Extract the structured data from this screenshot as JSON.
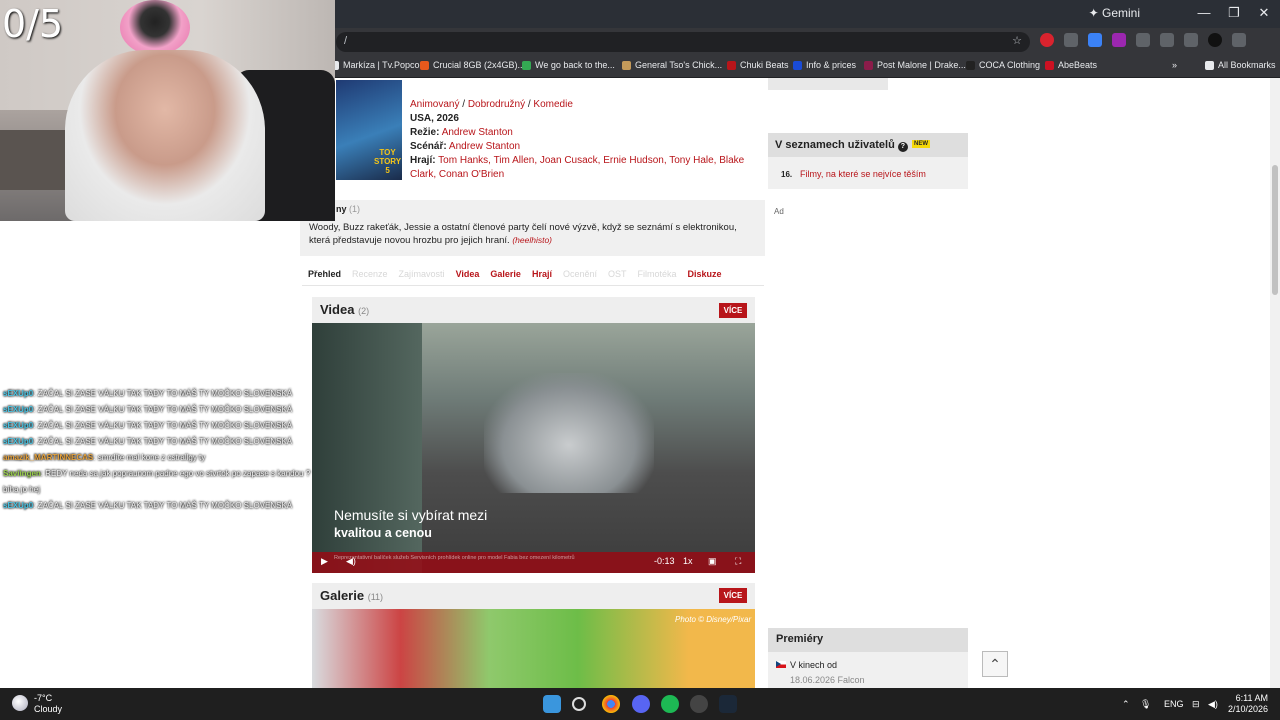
{
  "browser": {
    "gemini_label": "✦ Gemini",
    "minimize": "—",
    "restore": "❐",
    "close": "✕",
    "address": "/",
    "bookmarks": [
      {
        "label": "Markíza | Tv.Popcor...",
        "color": "#e8eaed"
      },
      {
        "label": "Crucial 8GB (2x4GB)...",
        "color": "#e8591c"
      },
      {
        "label": "We go back to the...",
        "color": "#34a853"
      },
      {
        "label": "General Tso's Chick...",
        "color": "#c49a5a"
      },
      {
        "label": "Chuki Beats",
        "color": "#b8151a"
      },
      {
        "label": "Info & prices",
        "color": "#1a4bd6"
      },
      {
        "label": "Post Malone | Drake...",
        "color": "#8b1c4a"
      },
      {
        "label": "COCA Clothing",
        "color": "#222222"
      },
      {
        "label": "AbeBeats",
        "color": "#cc1122"
      }
    ],
    "more_bookmarks": "»",
    "all_bookmarks": "All Bookmarks"
  },
  "film": {
    "genres": [
      "Animovaný",
      "Dobrodružný",
      "Komedie"
    ],
    "origin": "USA, 2026",
    "director_label": "Režie:",
    "director": "Andrew Stanton",
    "writer_label": "Scénář:",
    "writer": "Andrew Stanton",
    "cast_label": "Hrají:",
    "cast": "Tom Hanks, Tim Allen, Joan Cusack, Ernie Hudson, Tony Hale, Blake Clark, Conan O'Brien",
    "poster_logo_1": "TOY",
    "poster_logo_2": "STORY",
    "poster_logo_3": "5"
  },
  "plot": {
    "title": "ny",
    "count": "(1)",
    "text": "Woody, Buzz rakeťák, Jessie a ostatní členové party čelí nové výzvě, když se seznámí s elektronikou, která představuje novou hrozbu pro jejich hraní.",
    "author": "(heelhisto)"
  },
  "tabs": [
    {
      "label": "Přehled",
      "state": "active"
    },
    {
      "label": "Recenze",
      "state": "dim"
    },
    {
      "label": "Zajímavosti",
      "state": "dim"
    },
    {
      "label": "Videa",
      "state": "link"
    },
    {
      "label": "Galerie",
      "state": "link"
    },
    {
      "label": "Hrají",
      "state": "link"
    },
    {
      "label": "Ocenění",
      "state": "dim"
    },
    {
      "label": "OST",
      "state": "dim"
    },
    {
      "label": "Filmotéka",
      "state": "dim"
    },
    {
      "label": "Diskuze",
      "state": "link"
    }
  ],
  "videos": {
    "title": "Videa",
    "count": "(2)",
    "more": "VÍCE",
    "caption_line1": "Nemusíte si vybírat mezi",
    "caption_line2": "kvalitou a cenou",
    "disclaimer": "Reprezentativní balíček služeb Servisních prohlídek online pro model Fabia bez omezení kilometrů",
    "time": "-0:13",
    "speed": "1x",
    "play_icon": "▶",
    "volume_icon": "◀)",
    "pip_icon": "▣",
    "fullscreen_icon": "⛶"
  },
  "gallery": {
    "title": "Galerie",
    "count": "(11)",
    "more": "VÍCE",
    "credit": "Photo © Disney/Pixar"
  },
  "sidebar": {
    "lists_title": "V seznamech uživatelů",
    "help": "?",
    "new_badge": "NEW",
    "rank": "16.",
    "list_link": "Filmy, na které se nejvíce těším",
    "ad": "Ad",
    "premieres_title": "Premiéry",
    "premiere_label": "V kinech od",
    "premiere_date": "18.06.2026 Falcon",
    "scroll_top_icon": "⌃"
  },
  "stream": {
    "counter": "0/5",
    "chat": [
      {
        "user": "sEXUp0",
        "user_color": "#49c6e5",
        "msg": ": ZAČAL SI ZASE VÁLKU TAK TADY TO MÁŠ TY MOČKO SLOVENSKÁ"
      },
      {
        "user": "sEXUp0",
        "user_color": "#49c6e5",
        "msg": ": ZAČAL SI ZASE VÁLKU TAK TADY TO MÁŠ TY MOČKO SLOVENSKÁ"
      },
      {
        "user": "sEXUp0",
        "user_color": "#49c6e5",
        "msg": ": ZAČAL SI ZASE VÁLKU TAK TADY TO MÁŠ TY MOČKO SLOVENSKÁ"
      },
      {
        "user": "sEXUp0",
        "user_color": "#49c6e5",
        "msg": ": ZAČAL SI ZASE VÁLKU TAK TADY TO MÁŠ TY MOČKO SLOVENSKÁ"
      },
      {
        "user": "amazik_MARTINNECAS",
        "user_color": "#e6a23c",
        "msg": ": smrdíte mal kone z cstrallgy ty"
      },
      {
        "user": "Saviingen",
        "user_color": "#9ad14b",
        "msg": ": REDY neda sa jak popraunom padne ego vo stvrtok po zapase s kandou ?"
      },
      {
        "user": "",
        "user_color": "#ffffff",
        "msg": "bíha jo hej"
      },
      {
        "user": "sEXUp0",
        "user_color": "#49c6e5",
        "msg": ": ZAČAL SI ZASE VÁLKU TAK TADY TO MÁŠ TY MOČKO SLOVENSKÁ"
      }
    ]
  },
  "taskbar": {
    "temp": "-7°C",
    "weather": "Cloudy",
    "lang": "ENG",
    "time": "6:11 AM",
    "date": "2/10/2026",
    "tray_arrow": "⌃",
    "mic_icon": "🎙"
  },
  "colors": {
    "accent": "#b8151a",
    "chrome_dark": "#35363a"
  }
}
